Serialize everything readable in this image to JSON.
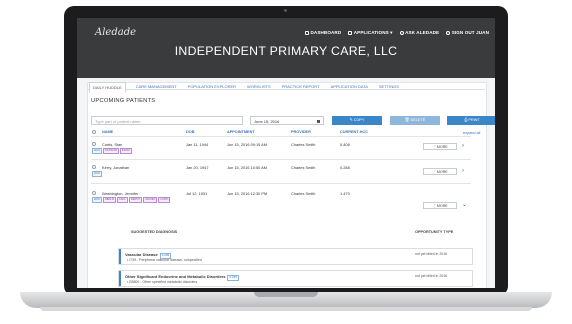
{
  "app": {
    "brand": "Aledade",
    "page_title": "INDEPENDENT PRIMARY CARE, LLC",
    "nav": [
      {
        "label": "DASHBOARD",
        "icon": "dashboard-icon"
      },
      {
        "label": "APPLICATIONS ▾",
        "icon": "grid-icon"
      },
      {
        "label": "ASK ALEDADE",
        "icon": "help-icon"
      },
      {
        "label": "SIGN OUT JUAN",
        "icon": "signout-icon"
      }
    ]
  },
  "tabs": [
    "DAILY HUDDLE",
    "CARE MANAGEMENT",
    "POPULATION EXPLORER",
    "WORKLISTS",
    "PRACTICE REPORT",
    "APPLICATION DATA",
    "SETTINGS"
  ],
  "section_title": "UPCOMING PATIENTS",
  "toolbar": {
    "search_placeholder": "Type part of patient name.",
    "date_value": "June 15, 2016",
    "copy_label": "✎ COPY",
    "delete_label": "🗑 DELETE",
    "print_label": "⎙ PRINT",
    "expand_label": "expand all"
  },
  "table": {
    "headers": [
      "NAME",
      "DOB",
      "APPOINTMENT",
      "PROVIDER",
      "CURRENT HCC"
    ],
    "rows": [
      {
        "name": "Curtis, Stan",
        "dob": "Jan 11, 1944",
        "appointment": "Jun 15, 2016 09:15 AM",
        "provider": "Charles Smith",
        "hcc": "0.406",
        "tags": [
          "HCC",
          "FATIGUE",
          "EXAM"
        ],
        "more": "⋮ MORE",
        "chevron": "›"
      },
      {
        "name": "Kerry, Jonathan",
        "dob": "Jan 20, 1947",
        "appointment": "Jun 15, 2016 10:50 AM",
        "provider": "Charles Smith",
        "hcc": "0.288",
        "tags": [
          "HCC"
        ],
        "more": "⋮ MORE",
        "chevron": "›"
      },
      {
        "name": "Washington, Jennifer",
        "dob": "Jul 12, 1931",
        "appointment": "Jun 15, 2016 12:30 PM",
        "provider": "Charles Smith",
        "hcc": "1.470",
        "tags": [
          "HCC",
          "MED-R",
          "FALL",
          "DEPCT",
          "ANXIET",
          "COPD"
        ],
        "more": "⋮ MORE",
        "chevron": "⌄"
      }
    ]
  },
  "diagnoses": {
    "header_left": "SUGGESTED DIAGNOSIS",
    "header_right": "OPPORTUNITY TYPE",
    "items": [
      {
        "name": "Vascular Disease",
        "badge": "0.299",
        "code": "• I739 - Peripheral vascular disease, unspecified",
        "status": "not yet billed in 2016"
      },
      {
        "name": "Other Significant Endocrine and Metabolic Disorders",
        "badge": "0.245",
        "code": "• E8809 - Other specified metabolic disorders",
        "status": "not yet billed in 2016"
      }
    ]
  },
  "colors": {
    "header": "#3a3b3d",
    "accent": "#3a86c8",
    "tag": "#8a4fa8"
  }
}
